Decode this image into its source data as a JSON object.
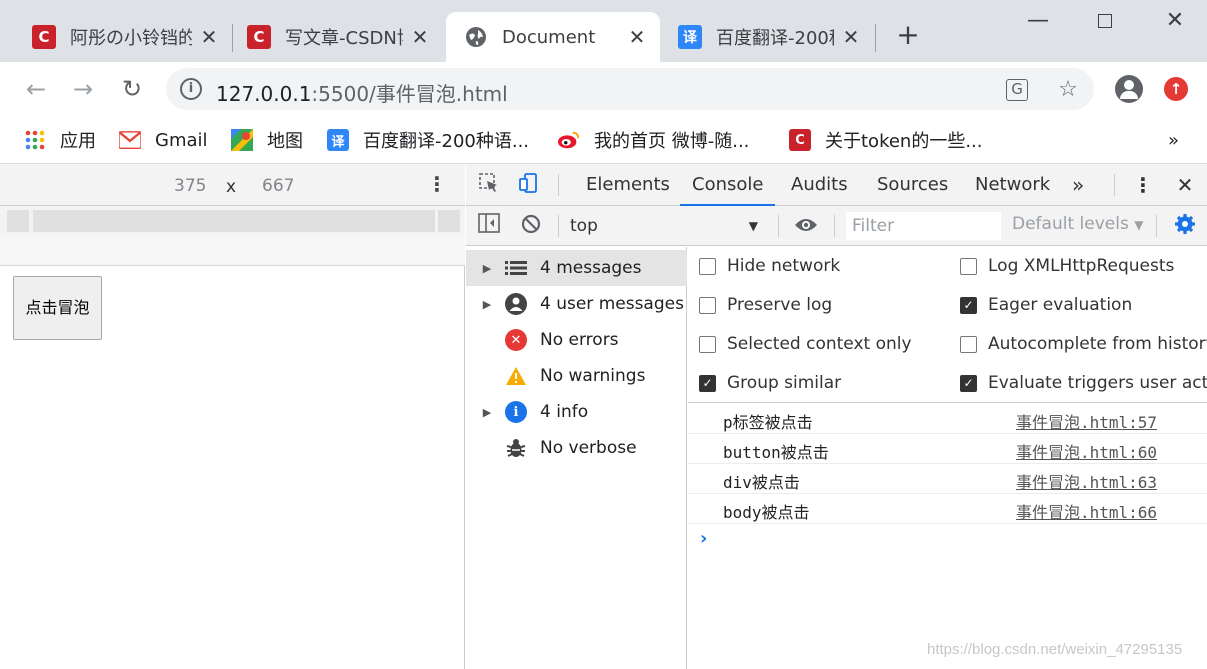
{
  "tabs": [
    {
      "title": "阿彤の小铃铛的",
      "icon": "csdn-icon",
      "active": false
    },
    {
      "title": "写文章-CSDN博",
      "icon": "csdn-icon",
      "active": false
    },
    {
      "title": "Document",
      "icon": "globe-icon",
      "active": true
    },
    {
      "title": "百度翻译-200种",
      "icon": "baidu-translate-icon",
      "active": false
    }
  ],
  "toolbar": {
    "url_host": "127.0.0.1",
    "url_rest": ":5500/事件冒泡.html"
  },
  "bookmarks": [
    {
      "label": "应用",
      "icon": "apps-grid-icon"
    },
    {
      "label": "Gmail",
      "icon": "gmail-icon"
    },
    {
      "label": "地图",
      "icon": "maps-icon"
    },
    {
      "label": "百度翻译-200种语...",
      "icon": "baidu-translate-icon"
    },
    {
      "label": "我的首页 微博-随...",
      "icon": "weibo-icon"
    },
    {
      "label": "关于token的一些...",
      "icon": "csdn-icon"
    }
  ],
  "device": {
    "width": "375",
    "times": "x",
    "height": "667",
    "button_label": "点击冒泡"
  },
  "devtools": {
    "tabs": [
      "Elements",
      "Console",
      "Audits",
      "Sources",
      "Network"
    ],
    "active_tab": "Console",
    "more": "»",
    "context": "top",
    "filter_placeholder": "Filter",
    "levels": "Default levels"
  },
  "sidebar": [
    {
      "label": "4 messages",
      "icon": "list-icon",
      "expandable": true,
      "selected": true
    },
    {
      "label": "4 user messages",
      "icon": "user-icon",
      "expandable": true,
      "selected": false
    },
    {
      "label": "No errors",
      "icon": "error-icon",
      "expandable": false,
      "selected": false
    },
    {
      "label": "No warnings",
      "icon": "warning-icon",
      "expandable": false,
      "selected": false
    },
    {
      "label": "4 info",
      "icon": "info-icon",
      "expandable": true,
      "selected": false
    },
    {
      "label": "No verbose",
      "icon": "bug-icon",
      "expandable": false,
      "selected": false
    }
  ],
  "settings": [
    {
      "label": "Hide network",
      "checked": false
    },
    {
      "label": "Log XMLHttpRequests",
      "checked": false
    },
    {
      "label": "Preserve log",
      "checked": false
    },
    {
      "label": "Eager evaluation",
      "checked": true
    },
    {
      "label": "Selected context only",
      "checked": false
    },
    {
      "label": "Autocomplete from history",
      "checked": false
    },
    {
      "label": "Group similar",
      "checked": true
    },
    {
      "label": "Evaluate triggers user activa",
      "checked": true
    }
  ],
  "logs": [
    {
      "message": "p标签被点击",
      "source": "事件冒泡.html:57"
    },
    {
      "message": "button被点击",
      "source": "事件冒泡.html:60"
    },
    {
      "message": "div被点击",
      "source": "事件冒泡.html:63"
    },
    {
      "message": "body被点击",
      "source": "事件冒泡.html:66"
    }
  ],
  "prompt": "›",
  "watermark": "https://blog.csdn.net/weixin_47295135",
  "colors": {
    "csdn": "#c9222b",
    "baidu": "#2f86f6",
    "accent": "#1a73e8",
    "error": "#e53935",
    "warning": "#f9ab00",
    "info": "#1a73e8"
  }
}
